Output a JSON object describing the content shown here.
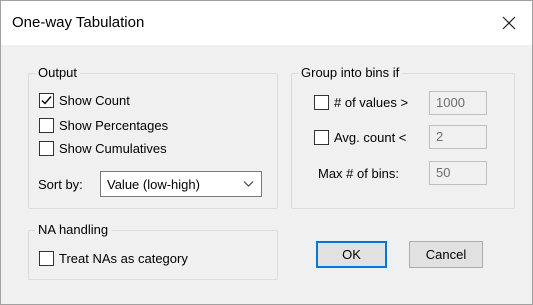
{
  "window": {
    "title": "One-way Tabulation",
    "close_icon": "close-icon"
  },
  "output": {
    "legend": "Output",
    "show_count": {
      "label": "Show Count",
      "checked": true
    },
    "show_percentages": {
      "label": "Show Percentages",
      "checked": false
    },
    "show_cumulatives": {
      "label": "Show Cumulatives",
      "checked": false
    },
    "sort_by_label": "Sort by:",
    "sort_by_value": "Value (low-high)"
  },
  "bins": {
    "legend": "Group into bins if",
    "num_values": {
      "label": "# of values >",
      "checked": false,
      "value": "1000"
    },
    "avg_count": {
      "label": "Avg. count <",
      "checked": false,
      "value": "2"
    },
    "max_bins": {
      "label": "Max # of bins:",
      "value": "50"
    }
  },
  "na": {
    "legend": "NA handling",
    "treat_nas": {
      "label": "Treat NAs as category",
      "checked": false
    }
  },
  "buttons": {
    "ok": "OK",
    "cancel": "Cancel"
  }
}
